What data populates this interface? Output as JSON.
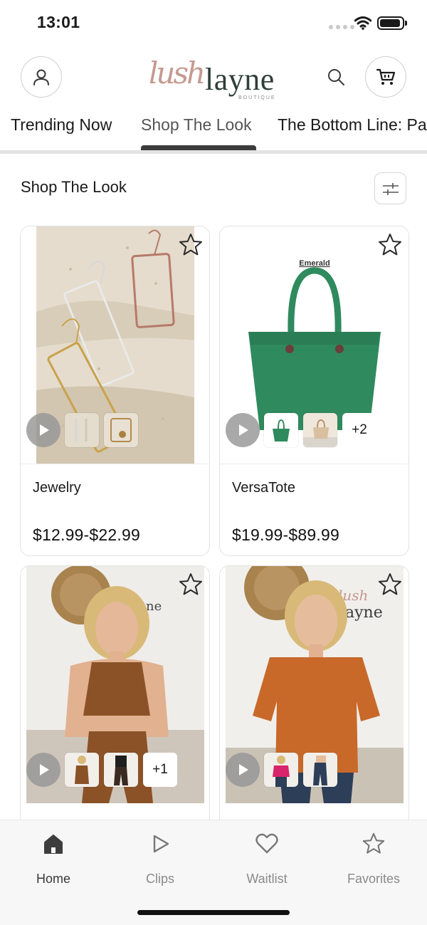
{
  "status_bar": {
    "time": "13:01"
  },
  "header": {
    "logo_script": "lush",
    "logo_main": "layne",
    "logo_sub": "BOUTIQUE"
  },
  "tabs": [
    {
      "label": "Trending Now",
      "active": false
    },
    {
      "label": "Shop The Look",
      "active": true
    },
    {
      "label": "The Bottom Line: Pa",
      "active": false
    }
  ],
  "section": {
    "title": "Shop The Look"
  },
  "products": [
    {
      "name": "Jewelry",
      "price": "$12.99-$22.99",
      "extra_count": ""
    },
    {
      "name": "VersaTote",
      "price": "$19.99-$89.99",
      "extra_count": "+2",
      "image_label": "Emerald"
    },
    {
      "name": "",
      "price": "",
      "extra_count": "+1"
    },
    {
      "name": "",
      "price": "",
      "extra_count": ""
    }
  ],
  "bottom_nav": [
    {
      "label": "Home",
      "icon": "home-icon",
      "active": true
    },
    {
      "label": "Clips",
      "icon": "play-icon",
      "active": false
    },
    {
      "label": "Waitlist",
      "icon": "heart-icon",
      "active": false
    },
    {
      "label": "Favorites",
      "icon": "star-icon",
      "active": false
    }
  ],
  "colors": {
    "accent_dark": "#3c3c3c",
    "tote_green": "#2f8a5e",
    "top_brown": "#8a5226",
    "top_orange": "#c8692a",
    "logo_rose": "#c59a90"
  }
}
